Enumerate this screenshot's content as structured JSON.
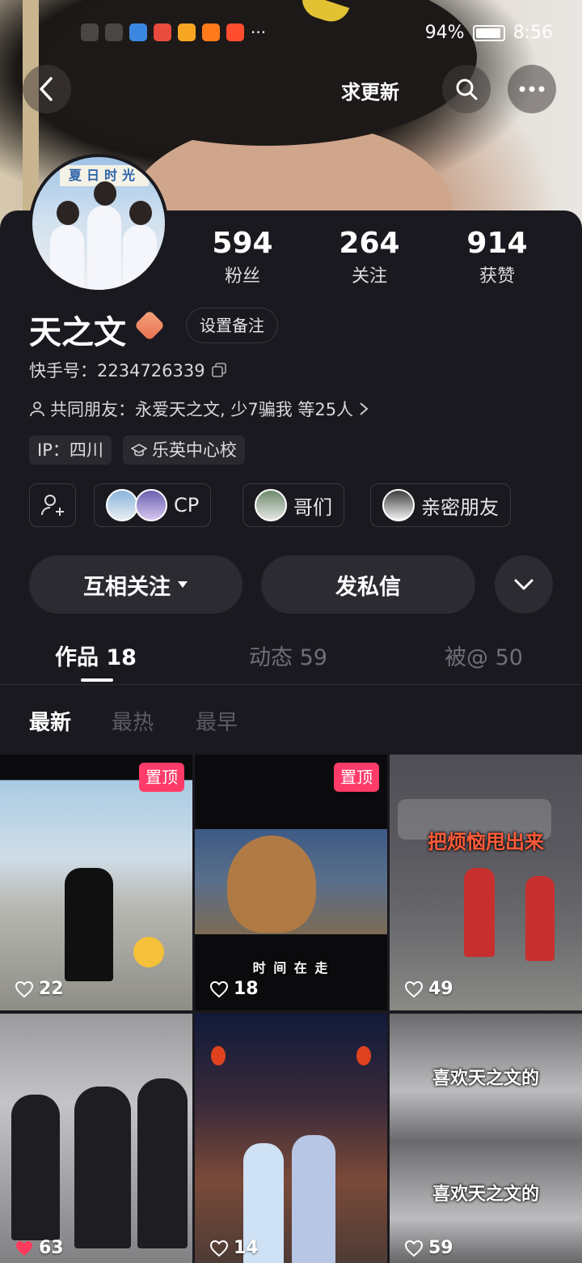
{
  "status_bar": {
    "battery": "94%",
    "time": "8:56"
  },
  "header": {
    "title": "求更新"
  },
  "profile": {
    "avatar_sign": "夏日时光",
    "name": "天之文",
    "remark_button": "设置备注",
    "kuaishou_id": "快手号：2234726339",
    "mutual_friends": "共同朋友：永爱天之文, 少7骗我 等25人",
    "ip": "IP：四川",
    "school": "乐英中心校"
  },
  "stats": [
    {
      "num": "594",
      "label": "粉丝"
    },
    {
      "num": "264",
      "label": "关注"
    },
    {
      "num": "914",
      "label": "获赞"
    }
  ],
  "relations": [
    {
      "label": "CP"
    },
    {
      "label": "哥们"
    },
    {
      "label": "亲密朋友"
    }
  ],
  "actions": {
    "follow": "互相关注",
    "message": "发私信"
  },
  "tabs": [
    {
      "label": "作品 18"
    },
    {
      "label": "动态 59"
    },
    {
      "label": "被@ 50"
    }
  ],
  "sort": [
    "最新",
    "最热",
    "最早"
  ],
  "videos": [
    {
      "likes": "22",
      "pinned": "置顶",
      "caption": ""
    },
    {
      "likes": "18",
      "pinned": "置顶",
      "caption": "时 间 在 走"
    },
    {
      "likes": "49",
      "pinned": "",
      "caption": "把烦恼甩出来"
    },
    {
      "likes": "63",
      "pinned": "",
      "caption": ""
    },
    {
      "likes": "14",
      "pinned": "",
      "caption": ""
    },
    {
      "likes": "59",
      "pinned": "",
      "caption": "喜欢天之文的"
    }
  ],
  "colors": {
    "accent_pink": "#ff3b6a",
    "panel_bg": "#1a191f",
    "button_bg": "#2c2b32"
  }
}
